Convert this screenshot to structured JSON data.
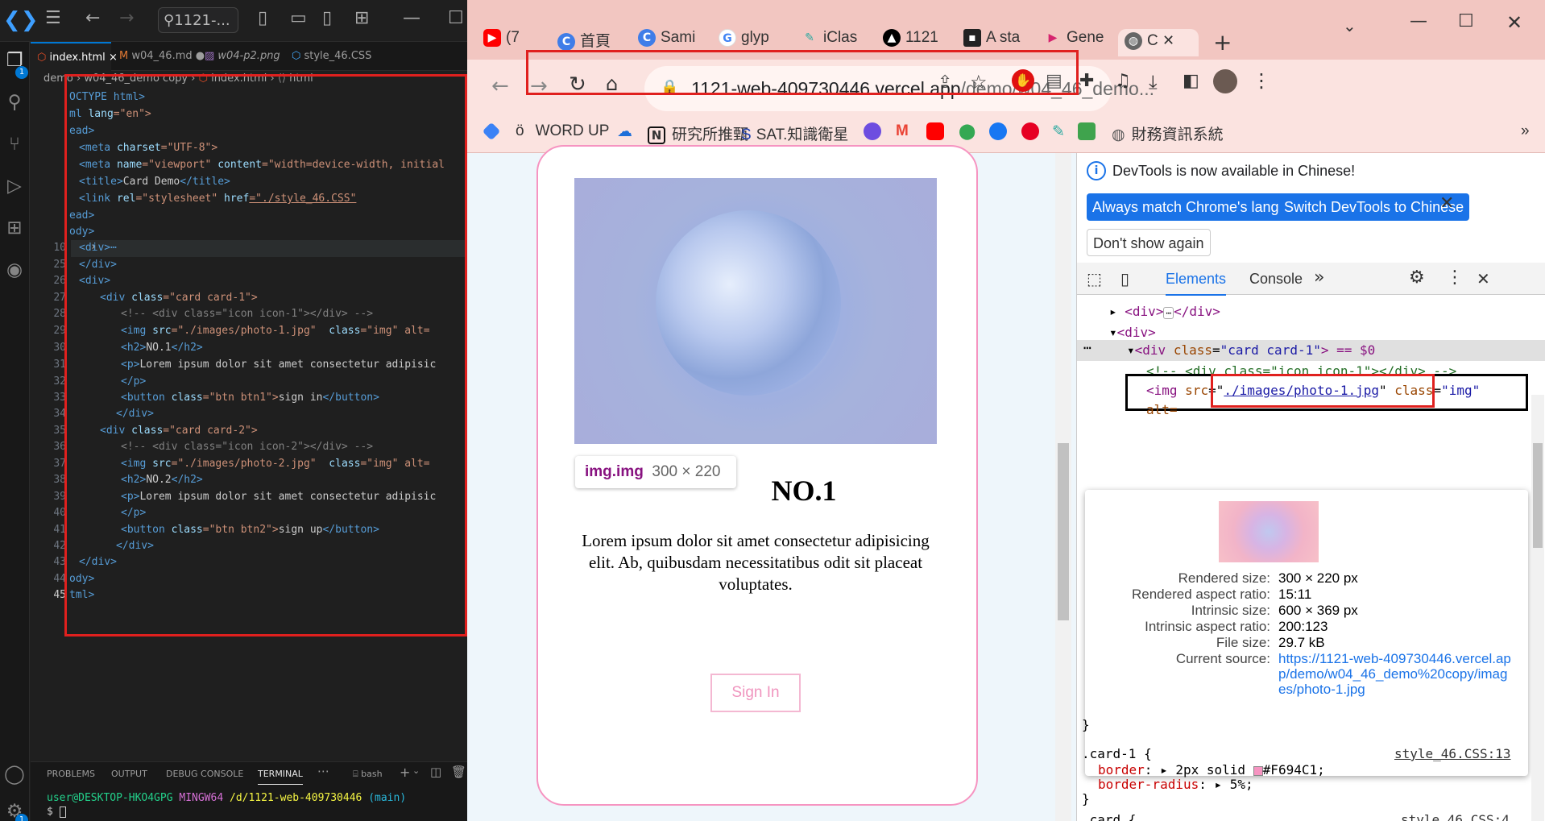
{
  "vscode": {
    "search_text": "1121-...",
    "tabs": [
      "index.html",
      "w04_46.md",
      "w04-p2.png",
      "style_46.CSS"
    ],
    "breadcrumb": [
      "demo",
      "w04_46_demo copy",
      "index.html",
      "html"
    ],
    "line_numbers": [
      "",
      "",
      "",
      "",
      "",
      "",
      "",
      "",
      "",
      "10",
      "25",
      "26",
      "27",
      "28",
      "29",
      "30",
      "31",
      "32",
      "33",
      "34",
      "35",
      "36",
      "37",
      "38",
      "39",
      "40",
      "41",
      "42",
      "43",
      "44",
      "45"
    ],
    "panel_tabs": [
      "PROBLEMS",
      "OUTPUT",
      "DEBUG CONSOLE",
      "TERMINAL"
    ],
    "terminal_shell": "bash",
    "terminal_user": "user@DESKTOP-HKO4GPG",
    "terminal_env": "MINGW64",
    "terminal_path": "/d/1121-web-409730446",
    "terminal_branch": "(main)",
    "terminal_prompt": "$",
    "badge_explorer": "1",
    "badge_settings": "1",
    "code": {
      "l1": "OCTYPE html>",
      "l2a": "ml ",
      "l2b": "lang",
      "l2c": "=\"en\">",
      "l3": "ead>",
      "l4a": "<meta ",
      "l4b": "charset",
      "l4c": "=\"UTF-8\">",
      "l5a": "<meta ",
      "l5b": "name",
      "l5c": "=\"viewport\" ",
      "l5d": "content",
      "l5e": "=\"width=device-width, initial",
      "l6a": "<title>",
      "l6b": "Card Demo",
      "l6c": "</title>",
      "l7a": "<link ",
      "l7b": "rel",
      "l7c": "=\"stylesheet\" ",
      "l7d": "href",
      "l7e": "=\"./style_46.CSS\"",
      "l8": "ead>",
      "l9": "ody>",
      "l10": "<div>⋯",
      "l25": "</div>",
      "l26": "<div>",
      "l27a": "<div ",
      "l27b": "class",
      "l27c": "=\"card card-1\">",
      "l28": "<!-- <div class=\"icon icon-1\"></div> -->",
      "l29a": "<img ",
      "l29b": "src",
      "l29c": "=\"./images/photo-1.jpg\"  ",
      "l29d": "class",
      "l29e": "=\"img\" alt=",
      "l30a": "<h2>",
      "l30b": "NO.1",
      "l30c": "</h2>",
      "l31a": "<p>",
      "l31b": "Lorem ipsum dolor sit amet consectetur adipisic",
      "l32": "</p>",
      "l33a": "<button ",
      "l33b": "class",
      "l33c": "=\"btn btn1\">",
      "l33d": "sign in",
      "l33e": "</button>",
      "l34": "</div>",
      "l35a": "<div ",
      "l35b": "class",
      "l35c": "=\"card card-2\">",
      "l36": "<!-- <div class=\"icon icon-2\"></div> -->",
      "l37a": "<img ",
      "l37b": "src",
      "l37c": "=\"./images/photo-2.jpg\"  ",
      "l37d": "class",
      "l37e": "=\"img\" alt=",
      "l38a": "<h2>",
      "l38b": "NO.2",
      "l38c": "</h2>",
      "l39a": "<p>",
      "l39b": "Lorem ipsum dolor sit amet consectetur adipisic",
      "l40": "</p>",
      "l41a": "<button ",
      "l41b": "class",
      "l41c": "=\"btn btn2\">",
      "l41d": "sign up",
      "l41e": "</button>",
      "l42": "</div>",
      "l43": "</div>",
      "l44": "ody>",
      "l45": "tml>"
    }
  },
  "chrome": {
    "tabs": [
      "(7",
      "首頁",
      "Sami",
      "glyp",
      "iClas",
      "1121",
      "A sta",
      "Gene",
      "C"
    ],
    "url_domain": "1121-web-409730446.vercel.app",
    "url_path": "/demo/w04_46_demo...",
    "bookmarks": [
      "WORD UP",
      "研究所推甄",
      "SAT.知識衛星",
      "財務資訊系統"
    ],
    "bookmark_more": "»"
  },
  "page": {
    "tooltip_tag": "img.img",
    "tooltip_size": "300 × 220",
    "heading": "NO.1",
    "paragraph": "Lorem ipsum dolor sit amet consectetur adipisicing elit. Ab, quibusdam necessitatibus odit sit placeat voluptates.",
    "button": "Sign In"
  },
  "devtools": {
    "info_text": "DevTools is now available in Chinese!",
    "btn_match": "Always match Chrome's language",
    "btn_switch": "Switch DevTools to Chinese",
    "btn_dont_show": "Don't show again",
    "tabs": [
      "Elements",
      "Console"
    ],
    "tree": {
      "div_collapsed": "<div>",
      "div_collapsed_tail": "</div>",
      "div_open": "<div>",
      "card_tag": "<div ",
      "card_attr": "class",
      "card_val": "\"card card-1\"",
      "card_tail": "> == $0",
      "comment": "<!-- <div class=\"icon icon-1\"></div> -->",
      "img_tag": "<img ",
      "img_attr": "src",
      "img_val": "./images/photo-1.jpg",
      "img_attr2": "class",
      "img_val2": "\"img\"",
      "alt_partial": "alt="
    },
    "popup": {
      "rows": [
        {
          "label": "Rendered size:",
          "value": "300 × 220 px"
        },
        {
          "label": "Rendered aspect ratio:",
          "value": "15:11"
        },
        {
          "label": "Intrinsic size:",
          "value": "600 × 369 px"
        },
        {
          "label": "Intrinsic aspect ratio:",
          "value": "200:123"
        },
        {
          "label": "File size:",
          "value": "29.7 kB"
        },
        {
          "label": "Current source:",
          "value": "https://1121-web-409730446.vercel.app/demo/w04_46_demo%20copy/images/photo-1.jpg"
        }
      ]
    },
    "styles": {
      "close1": "}",
      "rule1_selector": ".card-1 {",
      "rule1_source": "style_46.CSS:13",
      "rule1_prop1": "border",
      "rule1_val1": "2px solid",
      "rule1_color": "#F694C1",
      "rule1_prop2": "border-radius",
      "rule1_val2": "5%",
      "close2": "}",
      "rule2_selector": ".card {",
      "rule2_source": "style_46.CSS:4"
    }
  },
  "colors": {
    "card_border": "#F694C1",
    "vscode_accent": "#0078d4",
    "highlight": "#e0201e"
  }
}
